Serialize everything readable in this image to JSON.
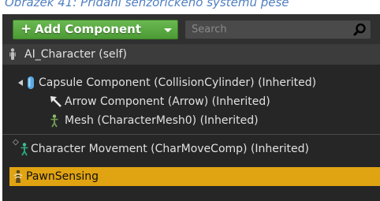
{
  "caption": "Obrázek 41: Přidání senzorického systému pese",
  "toolbar": {
    "add_label": "Add Component",
    "add_plus": "+",
    "search_placeholder": "Search"
  },
  "self_row": {
    "label": "AI_Character (self)"
  },
  "tree": {
    "capsule": "Capsule Component (CollisionCylinder) (Inherited)",
    "arrow": "Arrow Component (Arrow) (Inherited)",
    "mesh": "Mesh (CharacterMesh0) (Inherited)",
    "movement": "Character Movement (CharMoveComp) (Inherited)",
    "pawn_sensing": "PawnSensing"
  },
  "colors": {
    "panel_bg": "#262626",
    "add_button": "#56a83c",
    "selection": "#e0a312",
    "caption_text": "#4f7fc1"
  },
  "icons": {
    "search": "magnifier-icon",
    "self": "character-pawn-icon",
    "capsule": "capsule-icon",
    "arrow": "arrow-icon",
    "mesh": "skeletal-mesh-icon",
    "movement": "character-movement-icon",
    "pawn_sensing": "pawn-sensing-icon"
  }
}
